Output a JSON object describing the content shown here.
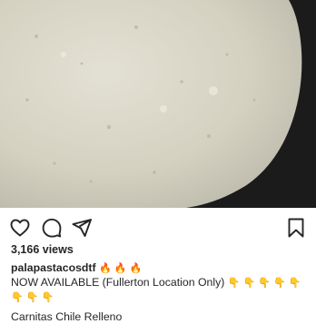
{
  "post": {
    "views": "3,166 views",
    "username": "palapastacosdtf",
    "fire_emojis": "🔥 🔥 🔥",
    "caption_line1": "NOW AVAILABLE (Fullerton Location Only)",
    "pointing_emojis_row1": "👇 👇 👇 👇 👇",
    "pointing_emojis_row2": "👇 👇 👇",
    "caption_line2": "Carnitas Chile Relleno"
  },
  "icons": {
    "like": "heart-icon",
    "comment": "comment-icon",
    "share": "share-icon",
    "save": "bookmark-icon"
  },
  "colors": {
    "text": "#262626",
    "background": "#ffffff",
    "media_dark": "#1b1b1b",
    "media_tortilla": "#d8d5c6"
  }
}
